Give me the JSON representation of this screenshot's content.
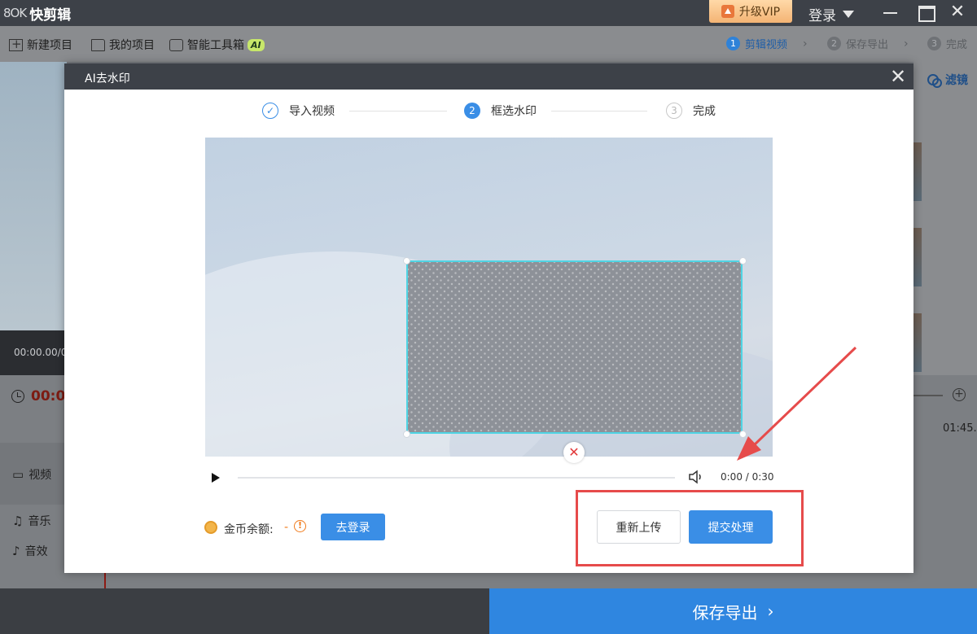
{
  "app": {
    "logo_mark": "8OK",
    "name": "快剪辑",
    "vip_label": "升级VIP",
    "login_label": "登录",
    "close_glyph": "✕"
  },
  "toolbar": {
    "new_project": "新建项目",
    "my_projects": "我的项目",
    "ai_toolbox": "智能工具箱",
    "ai_badge": "AI",
    "steps": [
      {
        "num": "1",
        "label": "剪辑视频",
        "active": true
      },
      {
        "num": "2",
        "label": "保存导出",
        "active": false
      },
      {
        "num": "3",
        "label": "完成",
        "active": false
      }
    ],
    "chevron": "›"
  },
  "background": {
    "preview_time": "00:00.00/0",
    "timeline_time": "00:0",
    "tracks": {
      "video": "视频",
      "music": "音乐",
      "sfx": "音效"
    },
    "ruler_time": "01:45.0",
    "filter_label": "滤镜",
    "save_export": "保存导出",
    "save_export_chevron": "›"
  },
  "modal": {
    "title": "AI去水印",
    "close_glyph": "✕",
    "steps": [
      {
        "num": "✓",
        "label": "导入视频",
        "state": "done"
      },
      {
        "num": "2",
        "label": "框选水印",
        "state": "active"
      },
      {
        "num": "3",
        "label": "完成",
        "state": "todo"
      }
    ],
    "delete_glyph": "✕",
    "player": {
      "time": "0:00 / 0:30",
      "progress": 0
    },
    "coin": {
      "label": "金币余额:",
      "value": "-",
      "warn_glyph": "!"
    },
    "login_button": "去登录",
    "reupload_button": "重新上传",
    "submit_button": "提交处理"
  },
  "colors": {
    "accent": "#3a8ee6",
    "selection_border": "#4fd4e4",
    "annotation": "#e64b4b",
    "coin": "#f07a1a"
  }
}
